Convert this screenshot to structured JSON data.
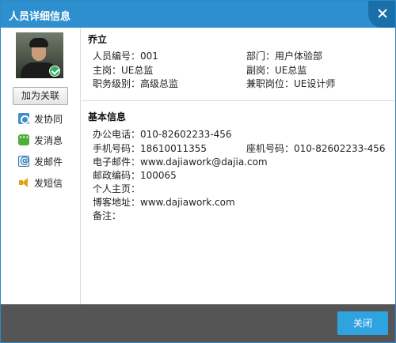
{
  "dialog": {
    "title": "人员详细信息"
  },
  "sidebar": {
    "link_button": "加为关联",
    "actions": [
      {
        "icon": "cooperate-icon",
        "label": "发协同"
      },
      {
        "icon": "message-icon",
        "label": "发消息"
      },
      {
        "icon": "email-icon",
        "label": "发邮件"
      },
      {
        "icon": "sms-icon",
        "label": "发短信"
      }
    ]
  },
  "person": {
    "name": "乔立",
    "employee_no": "人员编号：001",
    "department": "部门：用户体验部",
    "main_post": "主岗：UE总监",
    "deputy_post": "副岗：UE总监",
    "job_level": "职务级别：高级总监",
    "part_time_post": "兼职岗位：UE设计师"
  },
  "basic_info": {
    "title": "基本信息",
    "office_phone": "办公电话：010-82602233-456",
    "mobile": "手机号码：18610011355",
    "landline": "座机号码：010-82602233-456",
    "email": "电子邮件：www.dajiawork@dajia.com",
    "postal_code": "邮政编码：100065",
    "homepage": "个人主页：",
    "blog": "博客地址：www.dajiawork.com",
    "remarks": "备注："
  },
  "footer": {
    "close_label": "关闭"
  },
  "colors": {
    "titlebar": "#2e8fcf",
    "footer": "#555555",
    "close_button": "#2fa3e0",
    "online_badge": "#2fb35d"
  }
}
